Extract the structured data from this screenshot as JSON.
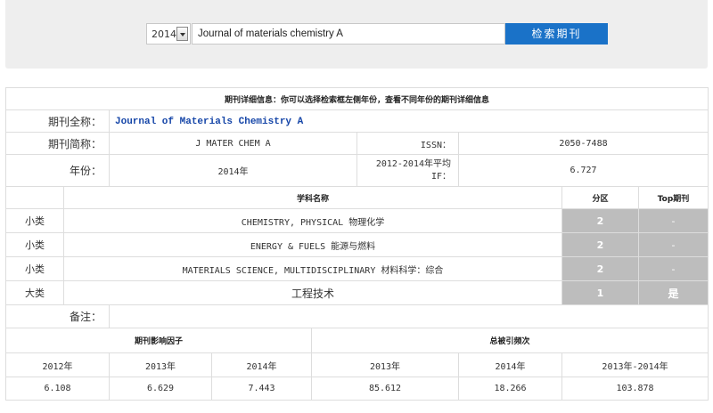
{
  "search": {
    "year": "2014",
    "journal_value": "Journal of materials chemistry A",
    "button_label": "检索期刊"
  },
  "detail": {
    "header": "期刊详细信息：你可以选择检索框左侧年份，查看不同年份的期刊详细信息",
    "full_name_label": "期刊全称：",
    "full_name": "Journal of Materials Chemistry A",
    "abbr_label": "期刊简称：",
    "abbr": "J MATER CHEM A",
    "issn_label": "ISSN：",
    "issn": "2050-7488",
    "year_label": "年份：",
    "year": "2014年",
    "avg_if_label": "2012-2014年平均IF：",
    "avg_if": "6.727",
    "subject_header": "学科名称",
    "zone_header": "分区",
    "top_header": "Top期刊",
    "subjects": [
      {
        "category": "小类",
        "name": "CHEMISTRY, PHYSICAL 物理化学",
        "zone": "2",
        "top": "-"
      },
      {
        "category": "小类",
        "name": "ENERGY & FUELS 能源与燃料",
        "zone": "2",
        "top": "-"
      },
      {
        "category": "小类",
        "name": "MATERIALS SCIENCE, MULTIDISCIPLINARY 材料科学：综合",
        "zone": "2",
        "top": "-"
      },
      {
        "category": "大类",
        "name": "工程技术",
        "zone": "1",
        "top": "是"
      }
    ],
    "remark_label": "备注：",
    "if_header": "期刊影响因子",
    "cites_header": "总被引频次",
    "year_cols": [
      "2012年",
      "2013年",
      "2014年",
      "2013年",
      "2014年",
      "2013年-2014年"
    ],
    "values": [
      "6.108",
      "6.629",
      "7.443",
      "85.612",
      "18.266",
      "103.878"
    ]
  },
  "colors": {
    "button": "#1a72c8",
    "link": "#1646a8",
    "zone_bg": "#bdbdbd"
  }
}
